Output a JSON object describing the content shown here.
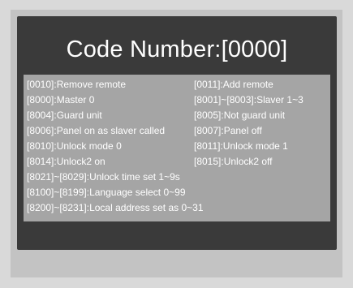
{
  "screen": {
    "title": "Code Number:[0000]"
  },
  "codes": [
    {
      "left": "[0010]:Remove remote",
      "right": "[0011]:Add remote"
    },
    {
      "left": "[8000]:Master 0",
      "right": "[8001]~[8003]:Slaver 1~3"
    },
    {
      "left": "[8004]:Guard unit",
      "right": "[8005]:Not guard unit"
    },
    {
      "left": "[8006]:Panel on as slaver called",
      "right": "[8007]:Panel off"
    },
    {
      "left": "[8010]:Unlock mode 0",
      "right": "[8011]:Unlock mode 1"
    },
    {
      "left": "[8014]:Unlock2 on",
      "right": "[8015]:Unlock2 off"
    }
  ],
  "long_codes": [
    "[8021]~[8029]:Unlock time set 1~9s",
    "[8100]~[8199]:Language select 0~99",
    "[8200]~[8231]:Local address set as 0~31"
  ]
}
